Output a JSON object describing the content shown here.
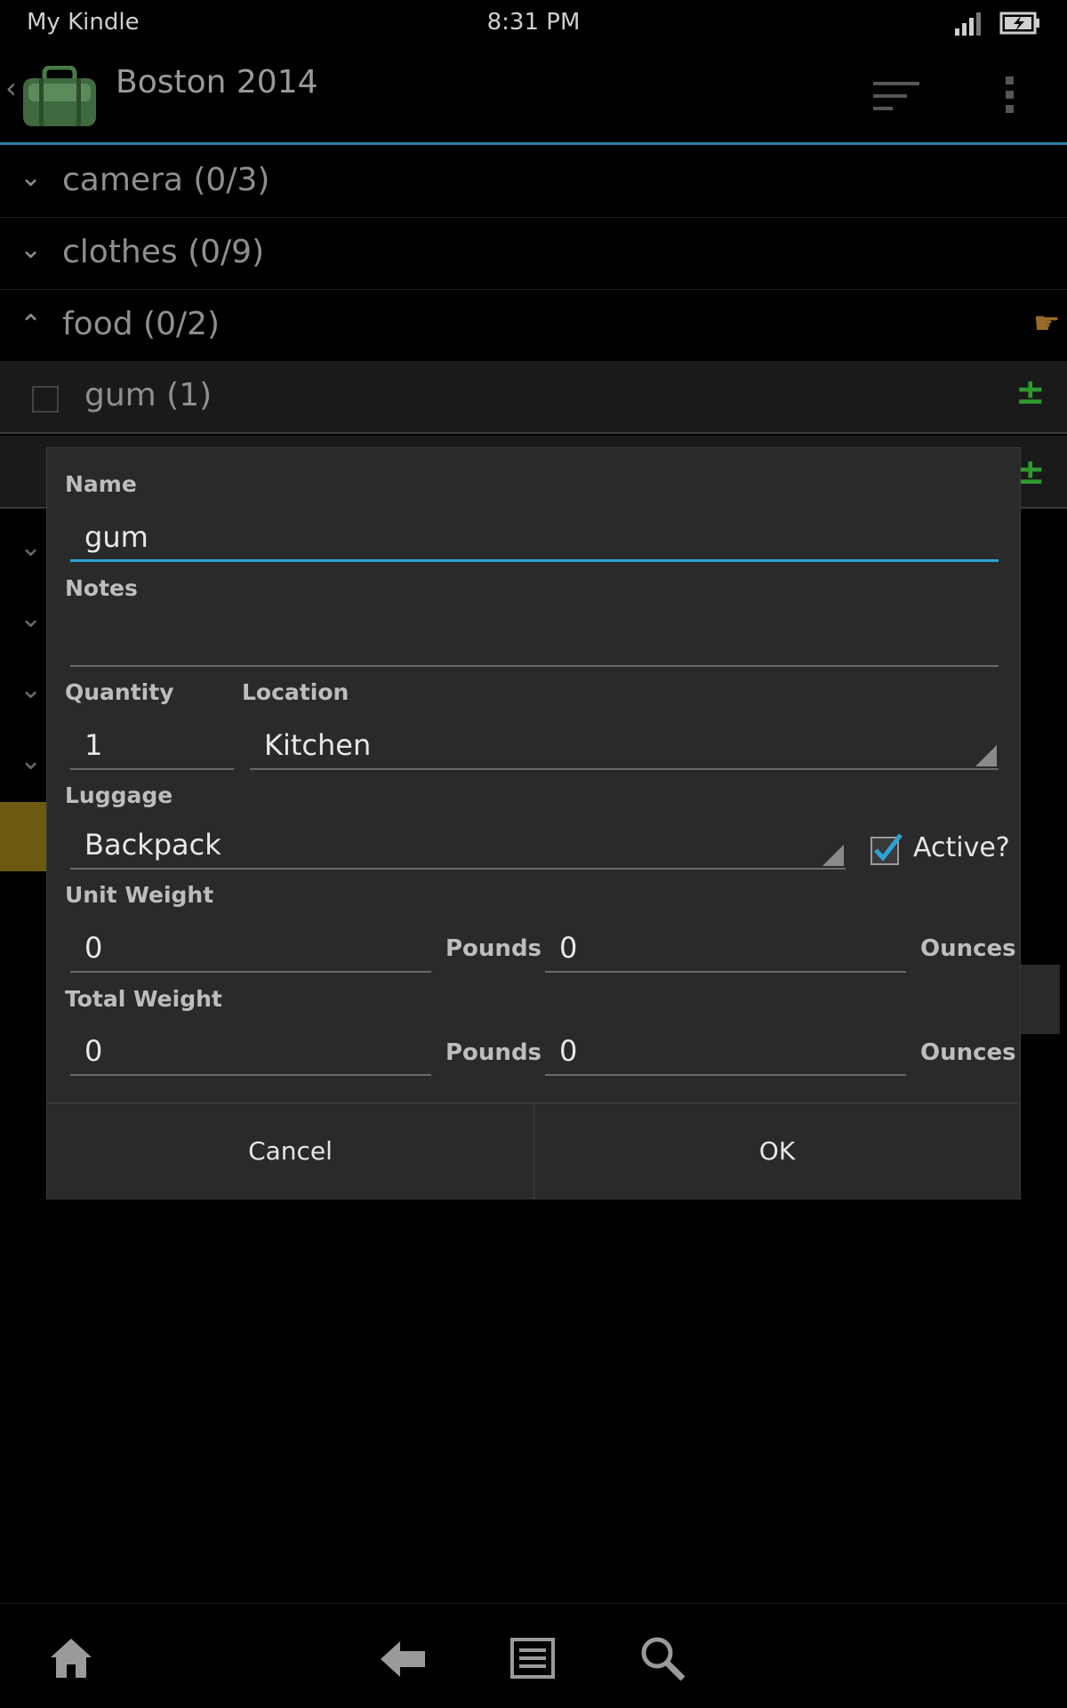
{
  "status_bar": {
    "carrier": "My Kindle",
    "time": "8:31 PM",
    "signal_icon": "signal-icon",
    "battery_icon": "battery-charging-icon"
  },
  "action_bar": {
    "title": "Boston 2014",
    "accent_color": "#2a7fa6"
  },
  "list": {
    "categories": [
      {
        "label": "camera (0/3)"
      },
      {
        "label": "clothes (0/9)"
      },
      {
        "label": "food (0/2)"
      }
    ],
    "items": [
      {
        "label": "gum (1)"
      }
    ]
  },
  "dialog": {
    "name": {
      "label": "Name",
      "value": "gum"
    },
    "notes": {
      "label": "Notes",
      "value": ""
    },
    "quantity": {
      "label": "Quantity",
      "value": "1"
    },
    "location": {
      "label": "Location",
      "value": "Kitchen"
    },
    "luggage": {
      "label": "Luggage",
      "value": "Backpack"
    },
    "active": {
      "label": "Active?",
      "checked": true
    },
    "unit_weight": {
      "label": "Unit Weight",
      "pounds": "0",
      "pounds_label": "Pounds",
      "ounces": "0",
      "ounces_label": "Ounces"
    },
    "total_weight": {
      "label": "Total Weight",
      "pounds": "0",
      "pounds_label": "Pounds",
      "ounces": "0",
      "ounces_label": "Ounces"
    },
    "cancel_label": "Cancel",
    "ok_label": "OK",
    "focus_color": "#2aa3d6"
  }
}
